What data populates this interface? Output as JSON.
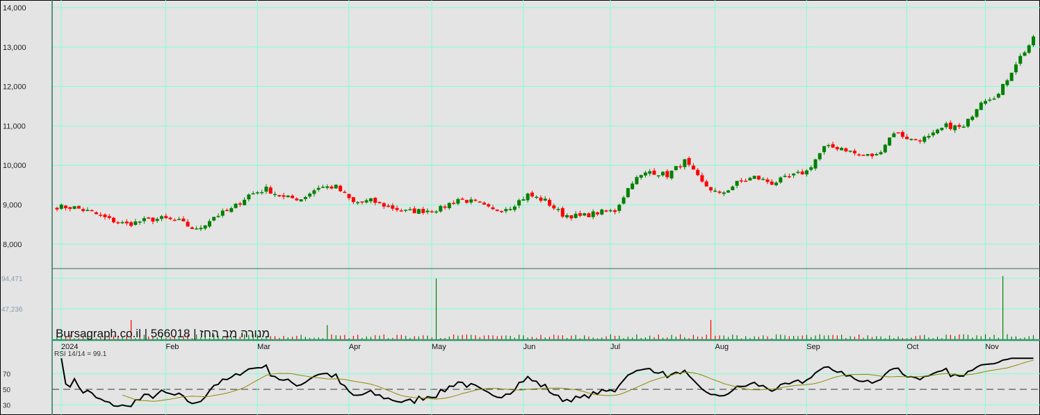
{
  "chart_data": {
    "type": "candlestick",
    "title": "Bursagraph.co.il | 566018 | מנורה מב החז",
    "price_axis": {
      "ticks": [
        "14,000",
        "13,000",
        "12,000",
        "11,000",
        "10,000",
        "9,000",
        "8,000"
      ],
      "tick_values": [
        14000,
        13000,
        12000,
        11000,
        10000,
        9000,
        8000
      ],
      "ylim": [
        8000,
        14000
      ]
    },
    "volume_axis": {
      "ticks": [
        "94,471",
        "47,236"
      ],
      "tick_values": [
        94471,
        47236
      ]
    },
    "rsi": {
      "label": "RSI 14/14 = 99.1",
      "ticks": [
        "70",
        "50",
        "30"
      ],
      "tick_values": [
        70,
        50,
        30
      ],
      "period": 14,
      "ma_period": 14
    },
    "months": [
      {
        "label": "2024",
        "day": 1
      },
      {
        "label": "Feb",
        "day": 25
      },
      {
        "label": "Mar",
        "day": 46
      },
      {
        "label": "Apr",
        "day": 67
      },
      {
        "label": "May",
        "day": 86
      },
      {
        "label": "Jun",
        "day": 107
      },
      {
        "label": "Jul",
        "day": 127
      },
      {
        "label": "Aug",
        "day": 151
      },
      {
        "label": "Sep",
        "day": 172
      },
      {
        "label": "Oct",
        "day": 195
      },
      {
        "label": "Nov",
        "day": 213
      }
    ],
    "trading_days": 225,
    "anchor_step_days": 4,
    "close_anchors": [
      8950,
      8930,
      8800,
      8620,
      8500,
      8600,
      8650,
      8580,
      8350,
      8700,
      8880,
      9250,
      9400,
      9180,
      9150,
      9450,
      9450,
      9050,
      9100,
      8950,
      8830,
      8850,
      8900,
      9150,
      9050,
      8850,
      8950,
      9250,
      9100,
      8750,
      8700,
      8800,
      8850,
      9600,
      9850,
      9750,
      10100,
      9550,
      9250,
      9550,
      9700,
      9550,
      9700,
      9850,
      10450,
      10450,
      10250,
      10250,
      10850,
      10650,
      10700,
      11000,
      10950,
      11650,
      11800,
      12600,
      13200
    ],
    "volume_base": 4000,
    "volume_spikes": [
      {
        "day": 17,
        "volume": 30000
      },
      {
        "day": 62,
        "volume": 22000
      },
      {
        "day": 87,
        "volume": 94000
      },
      {
        "day": 150,
        "volume": 30000
      },
      {
        "day": 217,
        "volume": 98000
      }
    ],
    "colors": {
      "up": "#008000",
      "down": "#ff0000",
      "grid": "#7fffd4",
      "rsi": "#000000",
      "rsi_ma": "#8a8a00",
      "ref": "#333333"
    }
  }
}
